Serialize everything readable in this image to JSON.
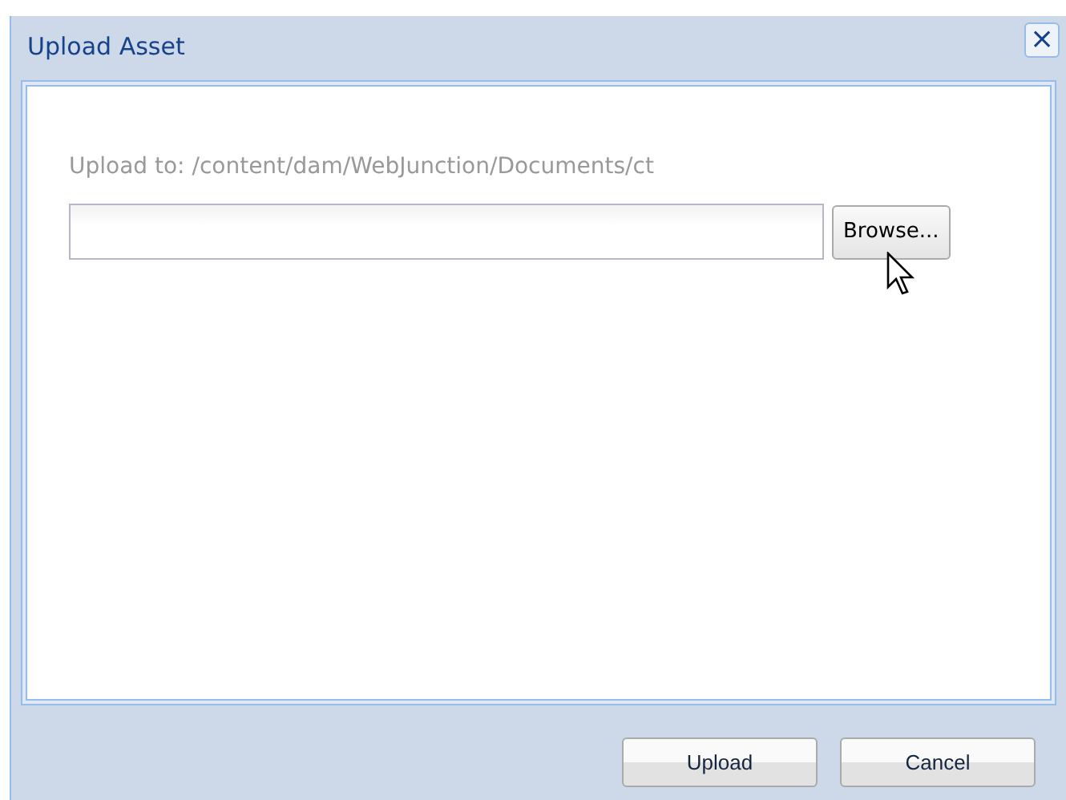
{
  "window": {
    "title": "Upload Asset",
    "close": "×"
  },
  "upload_to": "Upload to: /content/dam/WebJunction/Documents/ct",
  "browse_button": "Browse...",
  "buttons": [
    "Upload",
    "Cancel"
  ]
}
